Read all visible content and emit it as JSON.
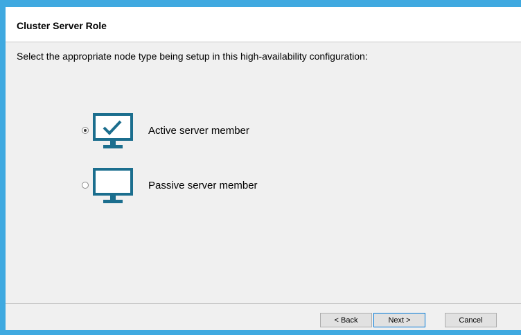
{
  "header": {
    "title": "Cluster Server Role"
  },
  "content": {
    "instruction": "Select the appropriate node type being setup in this high-availability configuration:",
    "options": [
      {
        "label": "Active server member",
        "selected": true,
        "icon": "monitor-check-icon"
      },
      {
        "label": "Passive server member",
        "selected": false,
        "icon": "monitor-icon"
      }
    ]
  },
  "footer": {
    "back_label": "< Back",
    "next_label": "Next >",
    "cancel_label": "Cancel"
  },
  "colors": {
    "frame": "#3fa9e0",
    "monitor": "#1b6e8e",
    "panel": "#f0f0f0"
  }
}
